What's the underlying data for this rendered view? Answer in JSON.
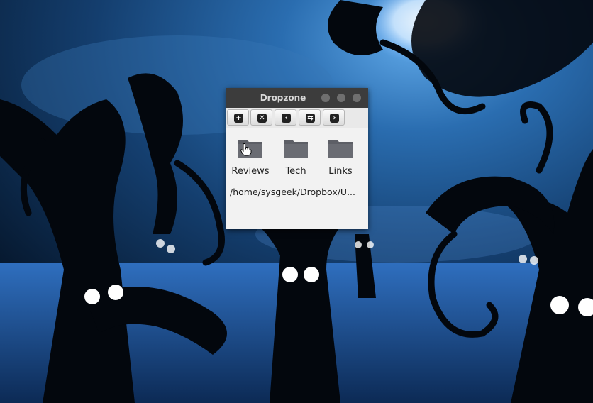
{
  "window": {
    "title": "Dropzone"
  },
  "toolbar": {
    "buttons": [
      {
        "icon": "plus-icon",
        "glyph": "+"
      },
      {
        "icon": "close-x-icon",
        "glyph": "✕"
      },
      {
        "icon": "back-arrow-icon",
        "glyph": "‹"
      },
      {
        "icon": "swap-arrows-icon",
        "glyph": "⇆"
      },
      {
        "icon": "forward-arrow-icon",
        "glyph": "›"
      }
    ]
  },
  "folders": [
    {
      "label": "Reviews",
      "icon": "folder-icon"
    },
    {
      "label": "Tech",
      "icon": "folder-icon"
    },
    {
      "label": "Links",
      "icon": "folder-icon"
    }
  ],
  "path_text": "/home/sysgeek/Dropbox/U...",
  "colors": {
    "titlebar": "#3c3c3c",
    "window_bg": "#f2f2f2",
    "folder": "#5d5f66",
    "wallpaper_blue": "#1e5a9a"
  }
}
